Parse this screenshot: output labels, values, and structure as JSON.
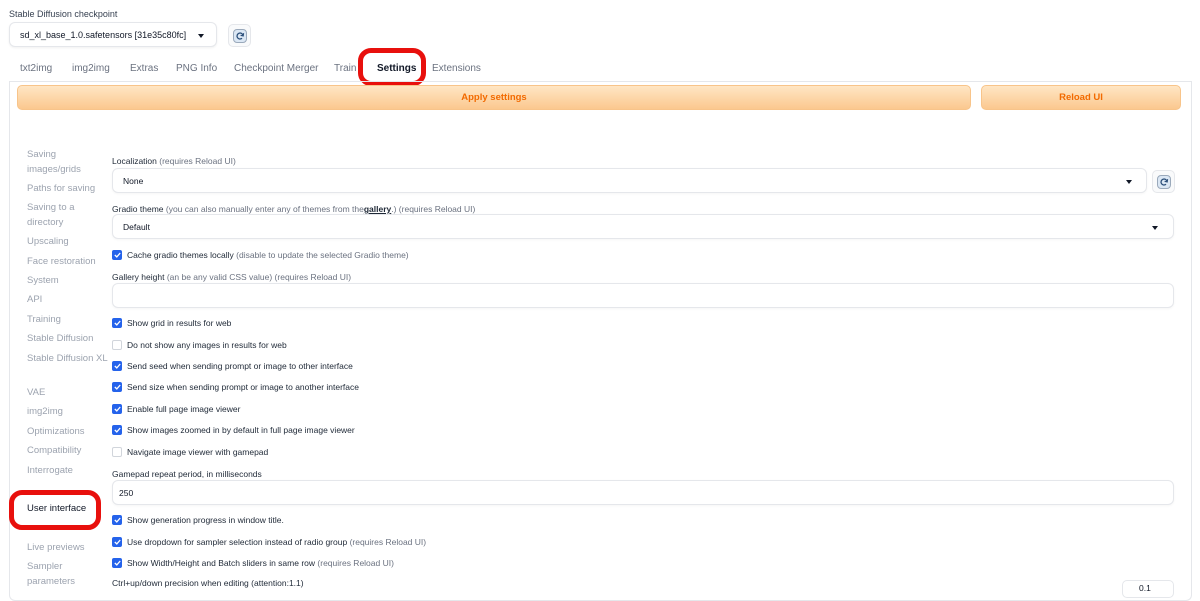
{
  "checkpoint": {
    "label": "Stable Diffusion checkpoint",
    "value": "sd_xl_base_1.0.safetensors [31e35c80fc]"
  },
  "tabs": [
    "txt2img",
    "img2img",
    "Extras",
    "PNG Info",
    "Checkpoint Merger",
    "Train",
    "Settings",
    "Extensions"
  ],
  "active_tab": "Settings",
  "actions": {
    "apply": "Apply settings",
    "reload": "Reload UI"
  },
  "sidebar": {
    "items": [
      "Saving images/grids",
      "Paths for saving",
      "Saving to a directory",
      "Upscaling",
      "Face restoration",
      "System",
      "API",
      "Training",
      "Stable Diffusion",
      "Stable Diffusion XL",
      "VAE",
      "img2img",
      "Optimizations",
      "Compatibility",
      "Interrogate",
      "User interface",
      "Live previews",
      "Sampler parameters"
    ],
    "active": "User interface"
  },
  "settings": {
    "localization": {
      "label": "Localization",
      "note": "(requires Reload UI)",
      "value": "None"
    },
    "gradio_theme": {
      "label": "Gradio theme",
      "note_before": "(you can also manually enter any of themes from the",
      "link": "gallery",
      "note_after": ".) (requires Reload UI)",
      "value": "Default"
    },
    "cache_themes": {
      "label": "Cache gradio themes locally",
      "note": "(disable to update the selected Gradio theme)",
      "checked": true
    },
    "gallery_height": {
      "label": "Gallery height",
      "note": "(an be any valid CSS value) (requires Reload UI)",
      "value": ""
    },
    "checkboxes": [
      {
        "label": "Show grid in results for web",
        "note": "",
        "checked": true
      },
      {
        "label": "Do not show any images in results for web",
        "note": "",
        "checked": false
      },
      {
        "label": "Send seed when sending prompt or image to other interface",
        "note": "",
        "checked": true
      },
      {
        "label": "Send size when sending prompt or image to another interface",
        "note": "",
        "checked": true
      },
      {
        "label": "Enable full page image viewer",
        "note": "",
        "checked": true
      },
      {
        "label": "Show images zoomed in by default in full page image viewer",
        "note": "",
        "checked": true
      },
      {
        "label": "Navigate image viewer with gamepad",
        "note": "",
        "checked": false
      }
    ],
    "gamepad_period": {
      "label": "Gamepad repeat period, in milliseconds",
      "value": "250"
    },
    "checkboxes2": [
      {
        "label": "Show generation progress in window title.",
        "note": "",
        "checked": true
      },
      {
        "label": "Use dropdown for sampler selection instead of radio group",
        "note": "(requires Reload UI)",
        "checked": true
      },
      {
        "label": "Show Width/Height and Batch sliders in same row",
        "note": "(requires Reload UI)",
        "checked": true
      }
    ],
    "precision": {
      "label": "Ctrl+up/down precision when editing (attention:1.1)",
      "value": "0.1"
    }
  },
  "colors": {
    "accent_orange": "#f26a00",
    "highlight_red": "#e8100d",
    "checkbox_blue": "#2563eb"
  }
}
